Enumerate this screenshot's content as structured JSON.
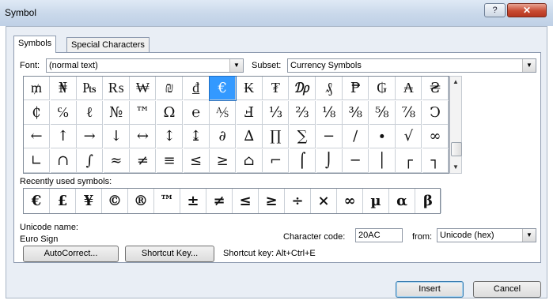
{
  "window": {
    "title": "Symbol",
    "help": "?",
    "close": "✕"
  },
  "tabs": [
    {
      "label": "Symbols",
      "mnemonic": "S"
    },
    {
      "label": "Special Characters",
      "mnemonic": "p"
    }
  ],
  "font": {
    "label": "Font:",
    "value": "(normal text)"
  },
  "subset": {
    "label": "Subset:",
    "value": "Currency Symbols"
  },
  "symbols": {
    "rows": [
      [
        "₥",
        "₦",
        "₧",
        "₨",
        "₩",
        "₪",
        "₫",
        "€",
        "₭",
        "₮",
        "₯",
        "₰",
        "₱",
        "₲",
        "₳",
        "₴"
      ],
      [
        "₵",
        "℅",
        "ℓ",
        "№",
        "™",
        "Ω",
        "℮",
        "⅍",
        "Ⅎ",
        "⅓",
        "⅔",
        "⅛",
        "⅜",
        "⅝",
        "⅞",
        "Ↄ"
      ],
      [
        "←",
        "↑",
        "→",
        "↓",
        "↔",
        "↕",
        "↨",
        "∂",
        "∆",
        "∏",
        "∑",
        "−",
        "∕",
        "∙",
        "√",
        "∞"
      ],
      [
        "∟",
        "∩",
        "∫",
        "≈",
        "≠",
        "≡",
        "≤",
        "≥",
        "⌂",
        "⌐",
        "⌠",
        "⌡",
        "─",
        "│",
        "┌",
        "┐"
      ]
    ],
    "selected": "€"
  },
  "recent": {
    "label": "Recently used symbols:",
    "items": [
      "€",
      "£",
      "¥",
      "©",
      "®",
      "™",
      "±",
      "≠",
      "≤",
      "≥",
      "÷",
      "×",
      "∞",
      "µ",
      "α",
      "β"
    ]
  },
  "unicode": {
    "label": "Unicode name:",
    "value": "Euro Sign"
  },
  "character_code": {
    "label": "Character code:",
    "value": "20AC"
  },
  "from": {
    "label": "from:",
    "value": "Unicode (hex)"
  },
  "buttons": {
    "autocorrect": "AutoCorrect...",
    "shortcut_key": "Shortcut Key...",
    "insert": "Insert",
    "cancel": "Cancel"
  },
  "shortcut_text": "Shortcut key: Alt+Ctrl+E"
}
